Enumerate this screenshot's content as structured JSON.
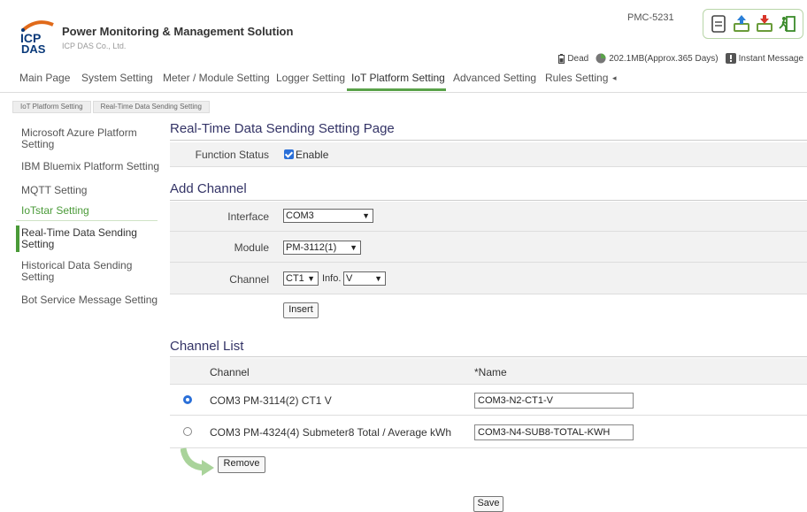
{
  "brand": {
    "logo_text": "ICP DAS",
    "title": "Power Monitoring & Management Solution",
    "subtitle": "ICP DAS Co., Ltd."
  },
  "header": {
    "model": "PMC-5231",
    "status_dead": "Dead",
    "storage": "202.1MB(Approx.365 Days)",
    "instant_message": "Instant Message"
  },
  "nav": {
    "tabs": [
      "Main Page",
      "System Setting",
      "Meter / Module Setting",
      "Logger Setting",
      "IoT Platform Setting",
      "Advanced Setting",
      "Rules Setting"
    ],
    "more": "◂"
  },
  "breadcrumb": [
    "IoT Platform Setting",
    "Real-Time Data Sending Setting"
  ],
  "sidebar": {
    "items": [
      "Microsoft Azure Platform Setting",
      "IBM Bluemix Platform Setting",
      "MQTT Setting",
      "IoTstar Setting",
      "Real-Time Data Sending Setting",
      "Historical Data Sending Setting",
      "Bot Service Message Setting"
    ]
  },
  "page": {
    "title": "Real-Time Data Sending Setting Page",
    "function_status_label": "Function Status",
    "enable_label": "Enable",
    "add_channel_title": "Add Channel",
    "interface_label": "Interface",
    "interface_value": "COM3",
    "module_label": "Module",
    "module_value": "PM-3112(1)",
    "channel_label": "Channel",
    "channel_value": "CT1",
    "info_label": "Info.",
    "info_value": "V",
    "insert_label": "Insert",
    "channel_list_title": "Channel List",
    "col_channel": "Channel",
    "col_name": "*Name",
    "rows": [
      {
        "channel": "COM3 PM-3114(2) CT1 V",
        "name": "COM3-N2-CT1-V"
      },
      {
        "channel": "COM3 PM-4324(4) Submeter8 Total / Average kWh",
        "name": "COM3-N4-SUB8-TOTAL-KWH"
      }
    ],
    "remove_label": "Remove",
    "save_label": "Save"
  }
}
